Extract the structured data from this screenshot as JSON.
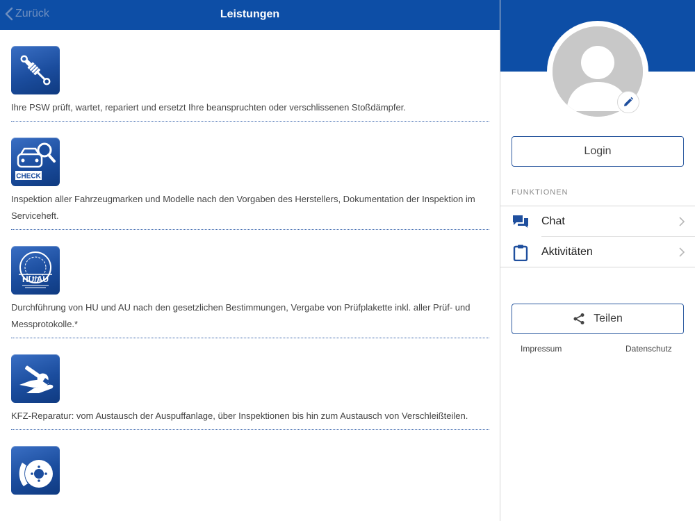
{
  "header": {
    "back_label": "Zurück",
    "title": "Leistungen"
  },
  "services": [
    {
      "icon": "shock-absorber-icon",
      "text": "Ihre PSW prüft, wartet, repariert und ersetzt Ihre beanspruchten oder verschlissenen Stoßdämpfer."
    },
    {
      "icon": "inspection-check-icon",
      "icon_label": "CHECK",
      "text": "Inspektion aller Fahrzeugmarken und Modelle nach den Vorgaben des Herstellers, Dokumentation der Inspektion im Serviceheft."
    },
    {
      "icon": "hu-au-icon",
      "icon_label": "HU/AU",
      "text": "Durchführung von HU und AU nach den gesetzlichen Bestimmungen, Vergabe von Prüfplakette inkl. aller Prüf- und Messprotokolle.*"
    },
    {
      "icon": "wrench-hand-icon",
      "text": "KFZ-Reparatur: vom Austausch der Auspuffanlage, über Inspektionen bis hin zum Austausch von Verschleißteilen."
    },
    {
      "icon": "brake-disc-icon",
      "text": ""
    }
  ],
  "sidebar": {
    "login_label": "Login",
    "section_title": "FUNKTIONEN",
    "menu": [
      {
        "label": "Chat",
        "icon": "chat-icon"
      },
      {
        "label": "Aktivitäten",
        "icon": "clipboard-icon"
      }
    ],
    "share_label": "Teilen",
    "imprint_label": "Impressum",
    "privacy_label": "Datenschutz"
  },
  "colors": {
    "brand_blue": "#0d4ea6",
    "divider": "#d6d6d6"
  }
}
